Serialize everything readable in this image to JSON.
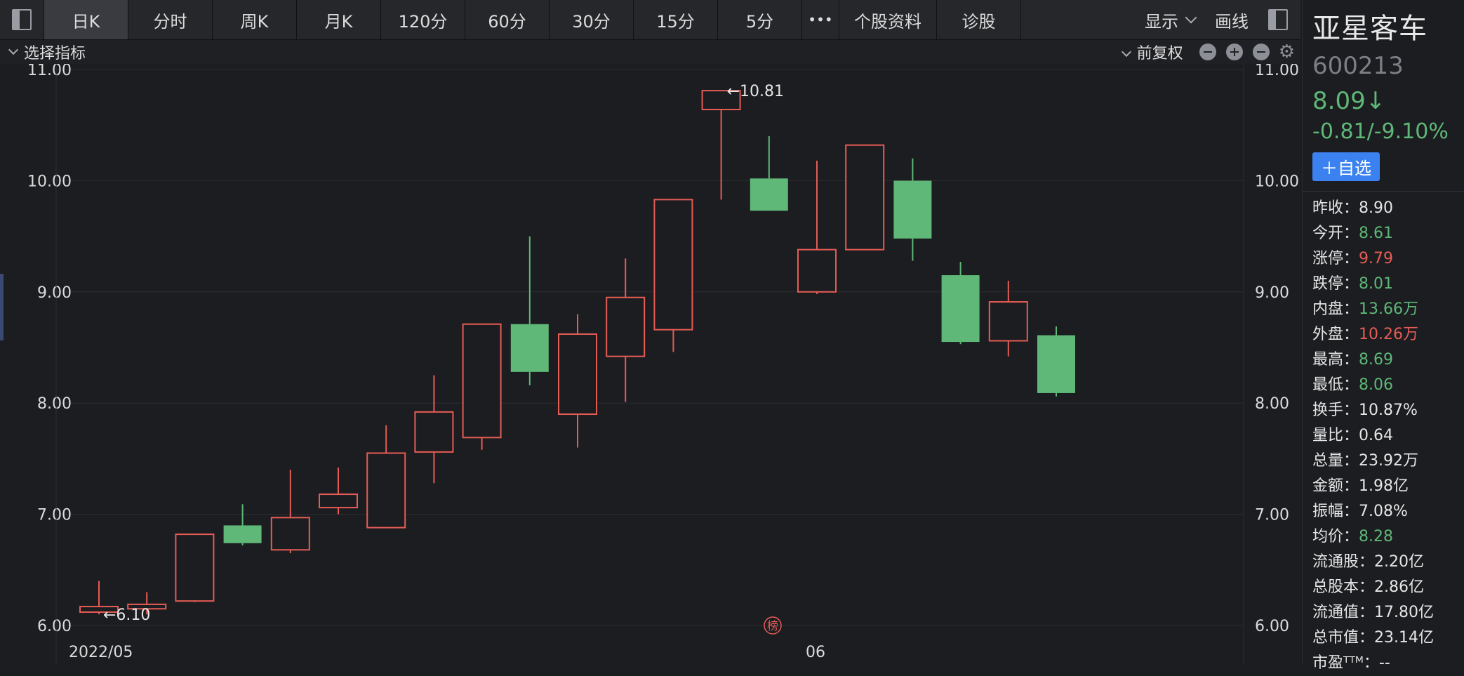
{
  "toolbar": {
    "tabs": [
      "日K",
      "分时",
      "周K",
      "月K",
      "120分",
      "60分",
      "30分",
      "15分",
      "5分"
    ],
    "more": "•••",
    "stock_profile": "个股资料",
    "diagnosis": "诊股",
    "display": "显示",
    "draw": "画线"
  },
  "subbar": {
    "indicator": "选择指标",
    "adjust": "前复权"
  },
  "stock": {
    "name": "亚星客车",
    "code": "600213",
    "price": "8.09↓",
    "change": "-0.81/-9.10%",
    "add_watch": "＋自选",
    "stats": [
      {
        "label": "昨收：",
        "value": "8.90",
        "color": "white"
      },
      {
        "label": "今开：",
        "value": "8.61",
        "color": "green"
      },
      {
        "label": "涨停：",
        "value": "9.79",
        "color": "red"
      },
      {
        "label": "跌停：",
        "value": "8.01",
        "color": "green"
      },
      {
        "label": "内盘：",
        "value": "13.66万",
        "color": "green"
      },
      {
        "label": "外盘：",
        "value": "10.26万",
        "color": "red"
      },
      {
        "label": "最高：",
        "value": "8.69",
        "color": "green"
      },
      {
        "label": "最低：",
        "value": "8.06",
        "color": "green"
      },
      {
        "label": "换手：",
        "value": "10.87%",
        "color": "white"
      },
      {
        "label": "量比：",
        "value": "0.64",
        "color": "white"
      },
      {
        "label": "总量：",
        "value": "23.92万",
        "color": "white"
      },
      {
        "label": "金额：",
        "value": "1.98亿",
        "color": "white"
      },
      {
        "label": "振幅：",
        "value": "7.08%",
        "color": "white"
      },
      {
        "label": "均价：",
        "value": "8.28",
        "color": "green"
      },
      {
        "label": "流通股：",
        "value": "2.20亿",
        "color": "white"
      },
      {
        "label": "总股本：",
        "value": "2.86亿",
        "color": "white"
      },
      {
        "label": "流通值：",
        "value": "17.80亿",
        "color": "white"
      },
      {
        "label": "总市值：",
        "value": "23.14亿",
        "color": "white"
      },
      {
        "label": "市盈ᵀᵀᴹ：",
        "value": "--",
        "color": "white"
      }
    ]
  },
  "chart_data": {
    "type": "candlestick",
    "y_ticks": [
      "11.00",
      "10.00",
      "9.00",
      "8.00",
      "7.00",
      "6.00"
    ],
    "ylim": [
      6.0,
      11.0
    ],
    "x_labels": [
      {
        "text": "2022/05",
        "index": 0
      },
      {
        "text": "06",
        "index": 15
      }
    ],
    "max_label": "←10.81",
    "min_label": "←6.10",
    "badge": "榜",
    "colors": {
      "up": "#e55c55",
      "down": "#5fb877",
      "grid": "#2c2d32",
      "axis_text": "#dcdcdc"
    },
    "candles": [
      {
        "open": 6.12,
        "close": 6.17,
        "high": 6.4,
        "low": 6.1
      },
      {
        "open": 6.15,
        "close": 6.19,
        "high": 6.3,
        "low": 6.1
      },
      {
        "open": 6.22,
        "close": 6.82,
        "high": 6.82,
        "low": 6.21
      },
      {
        "open": 6.9,
        "close": 6.74,
        "high": 7.09,
        "low": 6.72
      },
      {
        "open": 6.68,
        "close": 6.97,
        "high": 7.4,
        "low": 6.65
      },
      {
        "open": 7.06,
        "close": 7.18,
        "high": 7.42,
        "low": 7.0
      },
      {
        "open": 6.88,
        "close": 7.55,
        "high": 7.8,
        "low": 6.88
      },
      {
        "open": 7.56,
        "close": 7.92,
        "high": 8.25,
        "low": 7.28
      },
      {
        "open": 7.69,
        "close": 8.71,
        "high": 8.71,
        "low": 7.58
      },
      {
        "open": 8.71,
        "close": 8.28,
        "high": 9.5,
        "low": 8.16
      },
      {
        "open": 7.9,
        "close": 8.62,
        "high": 8.8,
        "low": 7.6
      },
      {
        "open": 8.42,
        "close": 8.95,
        "high": 9.3,
        "low": 8.01
      },
      {
        "open": 8.66,
        "close": 9.83,
        "high": 9.83,
        "low": 8.46
      },
      {
        "open": 10.64,
        "close": 10.81,
        "high": 10.81,
        "low": 9.83
      },
      {
        "open": 10.02,
        "close": 9.73,
        "high": 10.4,
        "low": 9.73
      },
      {
        "open": 9.0,
        "close": 9.38,
        "high": 10.18,
        "low": 8.98
      },
      {
        "open": 9.38,
        "close": 10.32,
        "high": 10.32,
        "low": 9.38
      },
      {
        "open": 10.0,
        "close": 9.48,
        "high": 10.2,
        "low": 9.28
      },
      {
        "open": 9.15,
        "close": 8.55,
        "high": 9.27,
        "low": 8.53
      },
      {
        "open": 8.56,
        "close": 8.91,
        "high": 9.1,
        "low": 8.42
      },
      {
        "open": 8.61,
        "close": 8.09,
        "high": 8.69,
        "low": 8.06
      }
    ]
  }
}
